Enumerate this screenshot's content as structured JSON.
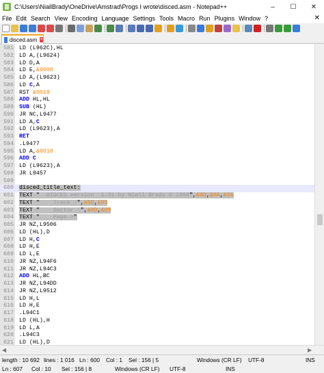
{
  "window": {
    "title": "C:\\Users\\NiallBrady\\OneDrive\\Amstrad\\Progs I wrote\\disced.asm - Notepad++",
    "minimize": "–",
    "maximize": "☐",
    "close": "✕"
  },
  "menu": [
    "File",
    "Edit",
    "Search",
    "View",
    "Encoding",
    "Language",
    "Settings",
    "Tools",
    "Macro",
    "Run",
    "Plugins",
    "Window",
    "?"
  ],
  "menu_close": "✕",
  "tab": {
    "label": "disced.asm",
    "close": "×"
  },
  "lines": [
    {
      "n": "581",
      "parts": [
        {
          "t": "LD (L962C),HL"
        }
      ]
    },
    {
      "n": "582",
      "parts": [
        {
          "t": "LD A,(L9624)"
        }
      ]
    },
    {
      "n": "583",
      "parts": [
        {
          "t": "LD D,A"
        }
      ]
    },
    {
      "n": "584",
      "parts": [
        {
          "t": "LD E,"
        },
        {
          "t": "&0000",
          "c": "num"
        }
      ]
    },
    {
      "n": "585",
      "parts": [
        {
          "t": "LD A,(L9623)"
        }
      ]
    },
    {
      "n": "586",
      "parts": [
        {
          "t": "LD "
        },
        {
          "t": "C",
          "c": "kw"
        },
        {
          "t": ",A"
        }
      ]
    },
    {
      "n": "587",
      "parts": [
        {
          "t": "RST "
        },
        {
          "t": "&0018",
          "c": "num"
        }
      ]
    },
    {
      "n": "588",
      "parts": [
        {
          "t": "ADD",
          "c": "kw"
        },
        {
          "t": " HL,HL"
        }
      ]
    },
    {
      "n": "589",
      "parts": [
        {
          "t": "SUB",
          "c": "kw"
        },
        {
          "t": " (HL)"
        }
      ]
    },
    {
      "n": "590",
      "parts": [
        {
          "t": "JR NC,L9477"
        }
      ]
    },
    {
      "n": "591",
      "parts": [
        {
          "t": "LD A,"
        },
        {
          "t": "C",
          "c": "kw"
        }
      ]
    },
    {
      "n": "592",
      "parts": [
        {
          "t": "LD (L9623),A"
        }
      ]
    },
    {
      "n": "593",
      "parts": [
        {
          "t": "RET",
          "c": "kw"
        }
      ]
    },
    {
      "n": "594",
      "parts": [
        {
          "t": ".L9477"
        }
      ]
    },
    {
      "n": "595",
      "parts": [
        {
          "t": "LD A,"
        },
        {
          "t": "&0010",
          "c": "num"
        }
      ]
    },
    {
      "n": "596",
      "parts": [
        {
          "t": "ADD",
          "c": "kw"
        },
        {
          "t": " "
        },
        {
          "t": "C",
          "c": "kw"
        }
      ]
    },
    {
      "n": "597",
      "parts": [
        {
          "t": "LD (L9623),A"
        }
      ]
    },
    {
      "n": "598",
      "parts": [
        {
          "t": "JR L9457"
        }
      ]
    },
    {
      "n": "599",
      "parts": []
    },
    {
      "n": "600",
      "parts": [
        {
          "t": "disced_title_text:",
          "sel": true
        }
      ]
    },
    {
      "n": "601",
      "parts": [
        {
          "t": "TEXT \"",
          "sel": true
        },
        {
          "t": "  DISCED version  1.31 by Niall Brady © 1988",
          "c": "str",
          "sel": true
        },
        {
          "t": "\",",
          "sel": true
        },
        {
          "t": "&0D",
          "c": "num",
          "sel": true
        },
        {
          "t": ",",
          "sel": true
        },
        {
          "t": "&0A",
          "c": "num",
          "sel": true
        },
        {
          "t": ",",
          "sel": true
        },
        {
          "t": "&0A",
          "c": "num",
          "sel": true
        }
      ]
    },
    {
      "n": "602",
      "parts": [
        {
          "t": "TEXT \"",
          "sel": true
        },
        {
          "t": "    Track :",
          "c": "str",
          "sel": true
        },
        {
          "t": "\",",
          "sel": true
        },
        {
          "t": "&0D",
          "c": "num",
          "sel": true
        },
        {
          "t": ",",
          "sel": true
        },
        {
          "t": "&09",
          "c": "num",
          "sel": true
        }
      ]
    },
    {
      "n": "603",
      "parts": [
        {
          "t": "TEXT \"",
          "sel": true
        },
        {
          "t": "    Sector :",
          "c": "str",
          "sel": true
        },
        {
          "t": "\",",
          "sel": true
        },
        {
          "t": "&0D",
          "c": "num",
          "sel": true
        },
        {
          "t": ",",
          "sel": true
        },
        {
          "t": "&09",
          "c": "num",
          "sel": true
        }
      ]
    },
    {
      "n": "604",
      "parts": [
        {
          "t": "TEXT \"",
          "sel": true
        },
        {
          "t": "    Page >",
          "c": "str",
          "sel": true
        },
        {
          "t": "\"",
          "sel": true
        }
      ]
    },
    {
      "n": "605",
      "parts": [
        {
          "t": "JR NZ,L9506"
        }
      ]
    },
    {
      "n": "606",
      "parts": [
        {
          "t": "LD (HL),D"
        }
      ]
    },
    {
      "n": "607",
      "parts": [
        {
          "t": "LD H,"
        },
        {
          "t": "C",
          "c": "kw"
        }
      ]
    },
    {
      "n": "608",
      "parts": [
        {
          "t": "LD H,E"
        }
      ]
    },
    {
      "n": "609",
      "parts": [
        {
          "t": "LD L,E"
        }
      ]
    },
    {
      "n": "610",
      "parts": [
        {
          "t": "JR NZ,L94F6"
        }
      ]
    },
    {
      "n": "611",
      "parts": [
        {
          "t": "JR NZ,L94C3"
        }
      ]
    },
    {
      "n": "612",
      "parts": [
        {
          "t": "ADD",
          "c": "kw"
        },
        {
          "t": " HL,BC"
        }
      ]
    },
    {
      "n": "613",
      "parts": [
        {
          "t": "JR NZ,L94DD"
        }
      ]
    },
    {
      "n": "614",
      "parts": [
        {
          "t": "JR NZ,L9512"
        }
      ]
    },
    {
      "n": "615",
      "parts": [
        {
          "t": "LD H,L"
        }
      ]
    },
    {
      "n": "616",
      "parts": [
        {
          "t": "LD H,E"
        }
      ]
    },
    {
      "n": "617",
      "parts": [
        {
          "t": ".L94C1"
        }
      ]
    },
    {
      "n": "618",
      "parts": [
        {
          "t": "LD (HL),H"
        }
      ]
    },
    {
      "n": "619",
      "parts": [
        {
          "t": "LD L,A"
        }
      ]
    },
    {
      "n": "620",
      "parts": [
        {
          "t": ".L94C3"
        }
      ]
    },
    {
      "n": "621",
      "parts": [
        {
          "t": "LD (HL),D"
        }
      ]
    },
    {
      "n": "622",
      "parts": [
        {
          "t": "JR NZ,L9504"
        }
      ]
    }
  ],
  "current_line": "600",
  "status": {
    "length": "length : 10 692",
    "lines": "lines : 1 016",
    "ln": "Ln : 600",
    "col": "Col : 1",
    "sel": "Sel : 156 | 5",
    "eol": "Windows (CR LF)",
    "encoding": "UTF-8",
    "mode": "INS",
    "ln2": "Ln : 607",
    "col2": "Col : 10",
    "sel2": "Sel : 156 | 8",
    "eol2": "Windows (CR LF)",
    "encoding2": "UTF-8",
    "mode2": "INS"
  },
  "icons": [
    "new-file",
    "open-file",
    "save",
    "save-all",
    "close",
    "close-all",
    "print",
    "cut",
    "copy",
    "paste",
    "undo",
    "redo",
    "find",
    "replace",
    "zoom-in",
    "zoom-out",
    "sync-v",
    "sync-h",
    "word-wrap",
    "all-chars",
    "indent-guide",
    "udl",
    "doc-map",
    "func-list",
    "folder",
    "monitor",
    "record",
    "stop",
    "play",
    "play-multi",
    "save-macro"
  ],
  "colors": {
    "keyword": "#0000ff",
    "number": "#ff8000",
    "string": "#9a9a9a",
    "selection": "#c0c0c0",
    "tab_accent": "#f5a623"
  }
}
